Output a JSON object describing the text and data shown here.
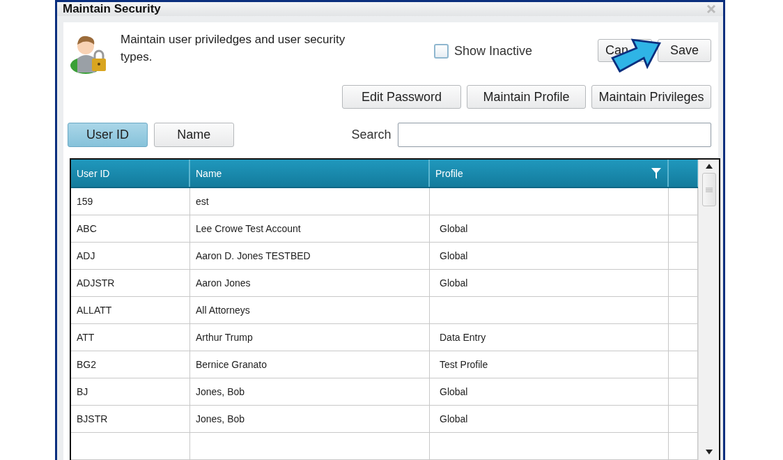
{
  "window": {
    "title": "Maintain Security"
  },
  "description": "Maintain user priviledges and user security types.",
  "show_inactive": {
    "label": "Show Inactive",
    "checked": false
  },
  "top_buttons": [
    "Can",
    "Save"
  ],
  "action_buttons": [
    "Edit Password",
    "Maintain Profile",
    "Maintain Privileges"
  ],
  "sort_toggles": [
    {
      "label": "User ID",
      "selected": true
    },
    {
      "label": "Name",
      "selected": false
    }
  ],
  "search": {
    "label": "Search"
  },
  "table": {
    "columns": [
      "User ID",
      "Name",
      "Profile"
    ],
    "rows": [
      {
        "user_id": "159",
        "name": "est"
      },
      {
        "user_id": "ABC",
        "name": "Lee Crowe Test Account",
        "profile": "Global"
      },
      {
        "user_id": "ADJ",
        "name": "Aaron D. Jones TESTBED",
        "profile": "Global"
      },
      {
        "user_id": "ADJSTR",
        "name": "Aaron Jones",
        "profile": "Global"
      },
      {
        "user_id": "ALLATT",
        "name": "All Attorneys"
      },
      {
        "user_id": "ATT",
        "name": "Arthur Trump",
        "profile": "Data Entry"
      },
      {
        "user_id": "BG2",
        "name": "Bernice Granato",
        "profile": "Test Profile"
      },
      {
        "user_id": "BJ",
        "name": "Jones, Bob",
        "profile": "Global"
      },
      {
        "user_id": "BJSTR",
        "name": "Jones, Bob",
        "profile": "Global"
      }
    ]
  }
}
